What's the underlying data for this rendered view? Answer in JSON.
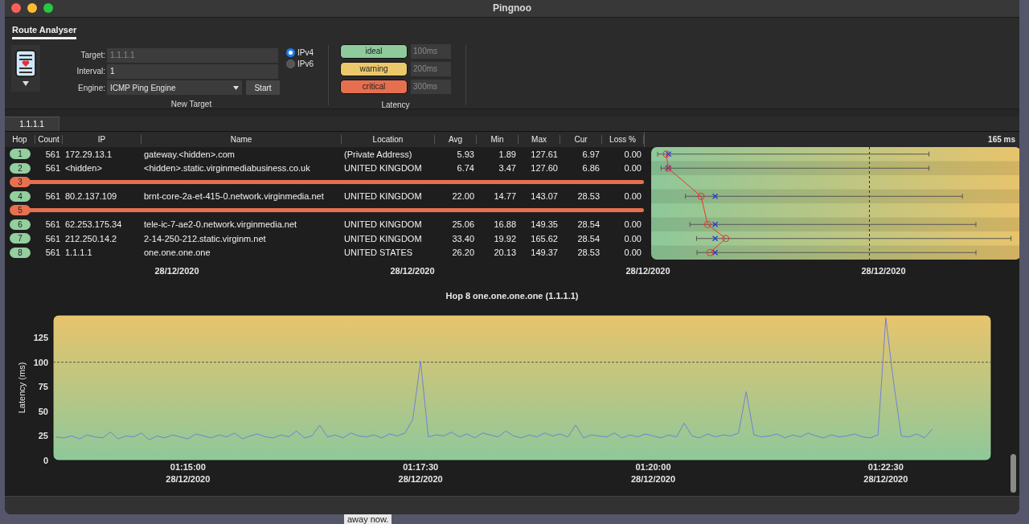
{
  "window": {
    "title": "Pingnoo"
  },
  "tabs": [
    {
      "label": "Route Analyser",
      "selected": true
    }
  ],
  "new_target": {
    "target": {
      "label": "Target:",
      "placeholder": "1.1.1.1"
    },
    "interval": {
      "label": "Interval:",
      "value": "1"
    },
    "engine": {
      "label": "Engine:",
      "value": "ICMP Ping Engine"
    },
    "start_button": "Start",
    "ip_versions": [
      {
        "label": "IPv4",
        "selected": true
      },
      {
        "label": "IPv6",
        "selected": false
      }
    ],
    "caption": "New Target"
  },
  "latency": {
    "levels": [
      {
        "label": "ideal",
        "color": "#8ecb9c",
        "placeholder": "100ms"
      },
      {
        "label": "warning",
        "color": "#ebc86a",
        "placeholder": "200ms"
      },
      {
        "label": "critical",
        "color": "#e66f4f",
        "placeholder": "300ms"
      }
    ],
    "caption": "Latency"
  },
  "targets": [
    {
      "label": "1.1.1.1",
      "selected": true
    }
  ],
  "table": {
    "columns": [
      "Hop",
      "Count",
      "IP",
      "Name",
      "Location",
      "Avg",
      "Min",
      "Max",
      "Cur",
      "Loss %"
    ],
    "graph_scale": "165 ms",
    "rows": [
      {
        "kind": "reply",
        "hop": "1",
        "count": "561",
        "ip": "172.29.13.1",
        "name": "gateway.<hidden>.com",
        "location": "(Private Address)",
        "avg": "5.93",
        "min": "1.89",
        "max": "127.61",
        "cur": "6.97",
        "loss": "0.00"
      },
      {
        "kind": "reply",
        "hop": "2",
        "count": "561",
        "ip": "<hidden>",
        "name": "<hidden>.static.virginmediabusiness.co.uk",
        "location": "UNITED KINGDOM",
        "avg": "6.74",
        "min": "3.47",
        "max": "127.60",
        "cur": "6.86",
        "loss": "0.00"
      },
      {
        "kind": "timeout",
        "hop": "3"
      },
      {
        "kind": "reply",
        "hop": "4",
        "count": "561",
        "ip": "80.2.137.109",
        "name": "brnt-core-2a-et-415-0.network.virginmedia.net",
        "location": "UNITED KINGDOM",
        "avg": "22.00",
        "min": "14.77",
        "max": "143.07",
        "cur": "28.53",
        "loss": "0.00"
      },
      {
        "kind": "timeout",
        "hop": "5"
      },
      {
        "kind": "reply",
        "hop": "6",
        "count": "561",
        "ip": "62.253.175.34",
        "name": "tele-ic-7-ae2-0.network.virginmedia.net",
        "location": "UNITED KINGDOM",
        "avg": "25.06",
        "min": "16.88",
        "max": "149.35",
        "cur": "28.54",
        "loss": "0.00"
      },
      {
        "kind": "reply",
        "hop": "7",
        "count": "561",
        "ip": "212.250.14.2",
        "name": "2-14-250-212.static.virginm.net",
        "location": "UNITED KINGDOM",
        "avg": "33.40",
        "min": "19.92",
        "max": "165.62",
        "cur": "28.54",
        "loss": "0.00"
      },
      {
        "kind": "reply",
        "hop": "8",
        "count": "561",
        "ip": "1.1.1.1",
        "name": "one.one.one.one",
        "location": "UNITED STATES",
        "avg": "26.20",
        "min": "20.13",
        "max": "149.37",
        "cur": "28.53",
        "loss": "0.00"
      }
    ]
  },
  "timeline_dates": [
    "28/12/2020",
    "28/12/2020",
    "28/12/2020",
    "28/12/2020"
  ],
  "latency_chart": {
    "title": "Hop 8 one.one.one.one (1.1.1.1)",
    "chart_data": {
      "type": "line",
      "ylabel": "Latency (ms)",
      "ylim": [
        0,
        148
      ],
      "yticks": [
        0,
        25,
        50,
        75,
        100,
        125
      ],
      "ref_lines": [
        {
          "axis": "y",
          "value": 100
        }
      ],
      "categories": [
        null,
        null,
        null,
        null,
        null,
        null,
        null,
        null,
        null,
        null,
        null,
        null,
        null,
        null,
        null,
        null,
        null,
        "01:15:00\n28/12/2020",
        null,
        null,
        null,
        null,
        null,
        null,
        null,
        null,
        null,
        null,
        null,
        null,
        null,
        null,
        null,
        null,
        null,
        null,
        null,
        null,
        null,
        null,
        null,
        null,
        null,
        null,
        null,
        null,
        null,
        "01:17:30\n28/12/2020",
        null,
        null,
        null,
        null,
        null,
        null,
        null,
        null,
        null,
        null,
        null,
        null,
        null,
        null,
        null,
        null,
        null,
        null,
        null,
        null,
        null,
        null,
        null,
        null,
        null,
        null,
        null,
        null,
        null,
        "01:20:00\n28/12/2020",
        null,
        null,
        null,
        null,
        null,
        null,
        null,
        null,
        null,
        null,
        null,
        null,
        null,
        null,
        null,
        null,
        null,
        null,
        null,
        null,
        null,
        null,
        null,
        null,
        null,
        null,
        null,
        null,
        null,
        "01:22:30\n28/12/2020",
        null,
        null,
        null,
        null,
        null,
        null
      ],
      "series": [
        {
          "color": "#6f82d8",
          "values": [
            24,
            23,
            25,
            22,
            26,
            24,
            23,
            29,
            22,
            25,
            24,
            28,
            21,
            25,
            23,
            26,
            24,
            22,
            27,
            25,
            23,
            26,
            24,
            28,
            22,
            25,
            27,
            24,
            23,
            26,
            24,
            30,
            23,
            25,
            36,
            24,
            26,
            23,
            28,
            25,
            24,
            26,
            23,
            27,
            25,
            28,
            42,
            101,
            24,
            26,
            25,
            29,
            24,
            27,
            23,
            28,
            26,
            24,
            30,
            25,
            23,
            26,
            24,
            28,
            25,
            27,
            24,
            36,
            23,
            26,
            25,
            24,
            28,
            23,
            26,
            24,
            27,
            25,
            23,
            26,
            24,
            38,
            25,
            23,
            27,
            24,
            26,
            25,
            28,
            70,
            26,
            24,
            25,
            27,
            23,
            26,
            24,
            28,
            25,
            23,
            26,
            24,
            25,
            27,
            24,
            23,
            26,
            145,
            80,
            25,
            24,
            27,
            23,
            32
          ]
        }
      ]
    }
  },
  "background_text": "away now."
}
